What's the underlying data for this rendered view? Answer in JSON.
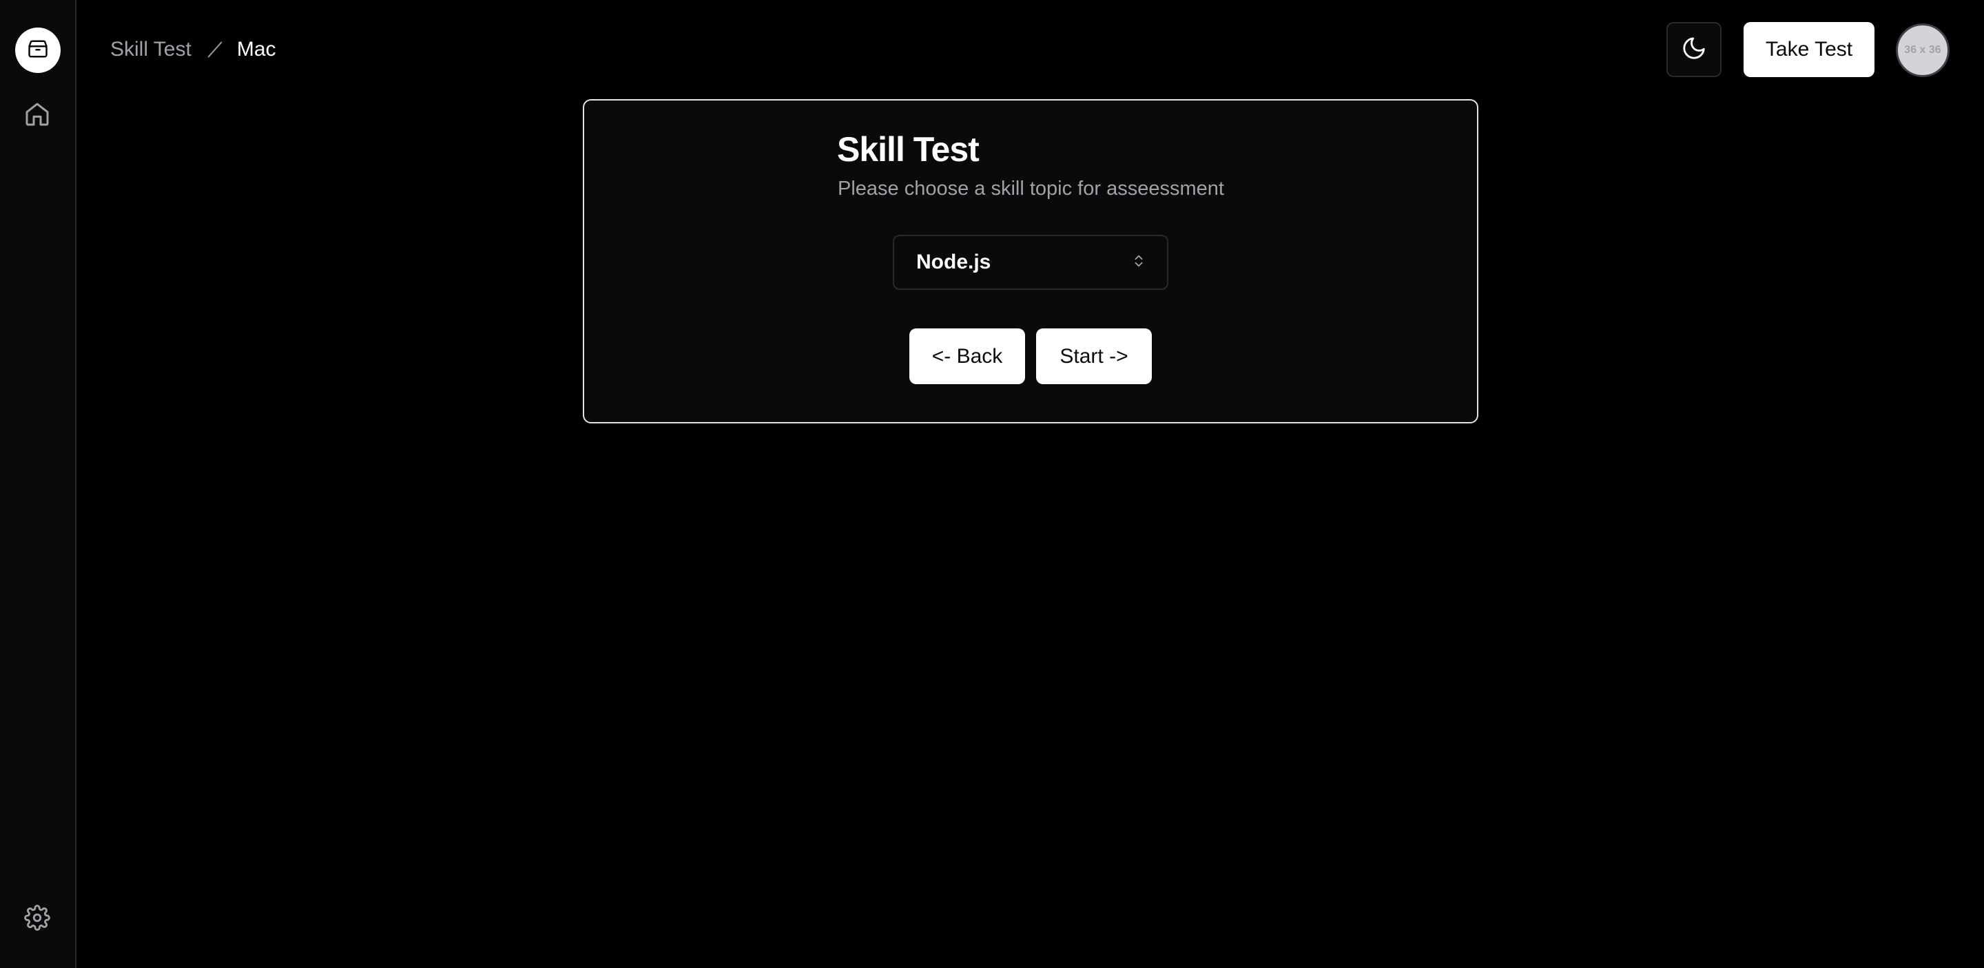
{
  "sidebar": {
    "logo_icon": "package-icon",
    "items": [
      {
        "icon": "home-icon"
      },
      {
        "icon": "gear-icon"
      }
    ]
  },
  "breadcrumb": {
    "items": [
      "Skill Test",
      "Mac"
    ],
    "separator_icon": "slash-icon"
  },
  "header": {
    "theme_toggle_icon": "moon-icon",
    "take_test_label": "Take Test",
    "avatar_text": "36 x 36"
  },
  "card": {
    "title": "Skill Test",
    "subtitle": "Please choose a skill topic for asseessment",
    "select": {
      "selected": "Node.js",
      "icon": "chevron-up-down-icon"
    },
    "back_label": "<- Back",
    "start_label": "Start ->"
  },
  "colors": {
    "background": "#000000",
    "card_background": "#0a0a0b",
    "button_background": "#ffffff",
    "muted_text": "#a1a1aa"
  }
}
